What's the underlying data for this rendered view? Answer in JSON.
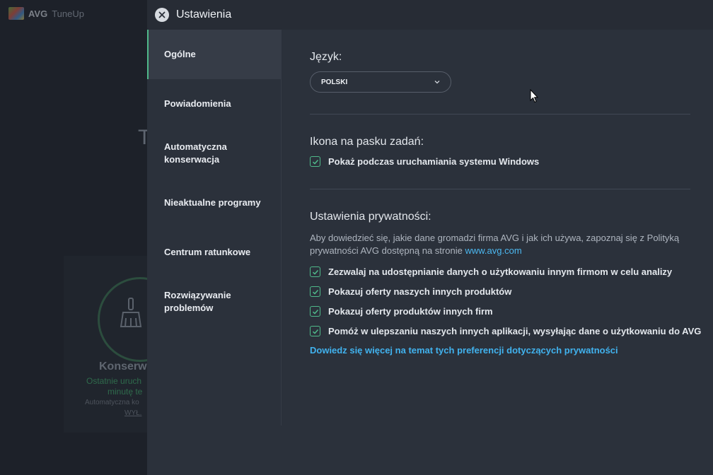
{
  "background_app": {
    "brand_avg": "AVG",
    "brand_tuneup": "TuneUp",
    "big_letter": "T",
    "card_title": "Konserwa",
    "card_line1": "Ostatnie uruch",
    "card_line2": "minutę te",
    "card_line3": "Automatyczna ko",
    "card_line4": "WYŁ."
  },
  "dialog": {
    "title": "Ustawienia",
    "close_icon": "close-icon"
  },
  "sidebar": {
    "items": [
      {
        "label": "Ogólne",
        "active": true
      },
      {
        "label": "Powiadomienia"
      },
      {
        "label": "Automatyczna konserwacja"
      },
      {
        "label": "Nieaktualne programy"
      },
      {
        "label": "Centrum ratunkowe"
      },
      {
        "label": "Rozwiązywanie problemów"
      }
    ]
  },
  "language": {
    "heading": "Język:",
    "selected": "POLSKI"
  },
  "taskbar": {
    "heading": "Ikona na pasku zadań:",
    "option": "Pokaż podczas uruchamiania systemu Windows"
  },
  "privacy": {
    "heading": "Ustawienia prywatności:",
    "description": "Aby dowiedzieć się, jakie dane gromadzi firma AVG i jak ich używa, zapoznaj się z Polityką prywatności AVG dostępną na stronie ",
    "description_link": "www.avg.com",
    "options": [
      "Zezwalaj na udostępnianie danych o użytkowaniu innym firmom w celu analizy",
      "Pokazuj oferty naszych innych produktów",
      "Pokazuj oferty produktów innych firm",
      "Pomóż w ulepszaniu naszych innych aplikacji, wysyłając dane o użytkowaniu do AVG"
    ],
    "learn_more": "Dowiedz się więcej na temat tych preferencji dotyczących prywatności"
  },
  "colors": {
    "accent_green": "#4fb98a",
    "link_blue": "#41b2ee"
  }
}
